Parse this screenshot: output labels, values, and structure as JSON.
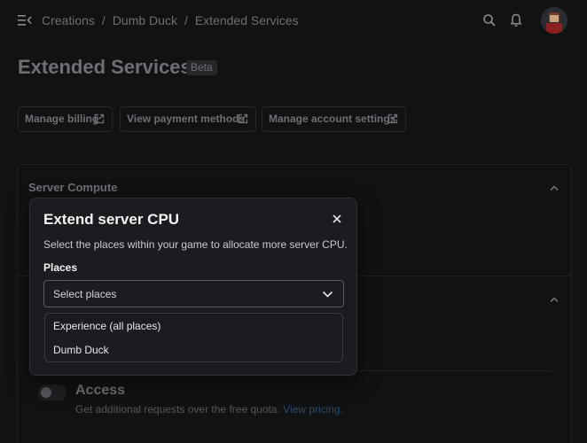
{
  "breadcrumb": [
    "Creations",
    "Dumb Duck",
    "Extended Services"
  ],
  "page": {
    "title": "Extended Services",
    "badge": "Beta"
  },
  "links": [
    {
      "label": "Manage billing"
    },
    {
      "label": "View payment methods"
    },
    {
      "label": "Manage account settings"
    }
  ],
  "sections": {
    "server_compute": "Server Compute"
  },
  "access": {
    "title": "Access",
    "description": "Get additional requests over the free quota. ",
    "link": "View pricing."
  },
  "modal": {
    "title": "Extend server CPU",
    "description": "Select the places within your game to allocate more server CPU.",
    "places_label": "Places",
    "select_placeholder": "Select places",
    "options": [
      "Experience (all places)",
      "Dumb Duck"
    ]
  },
  "colors": {
    "background": "#111214",
    "modal": "#1b1c1f",
    "link": "#2f4a6a"
  }
}
